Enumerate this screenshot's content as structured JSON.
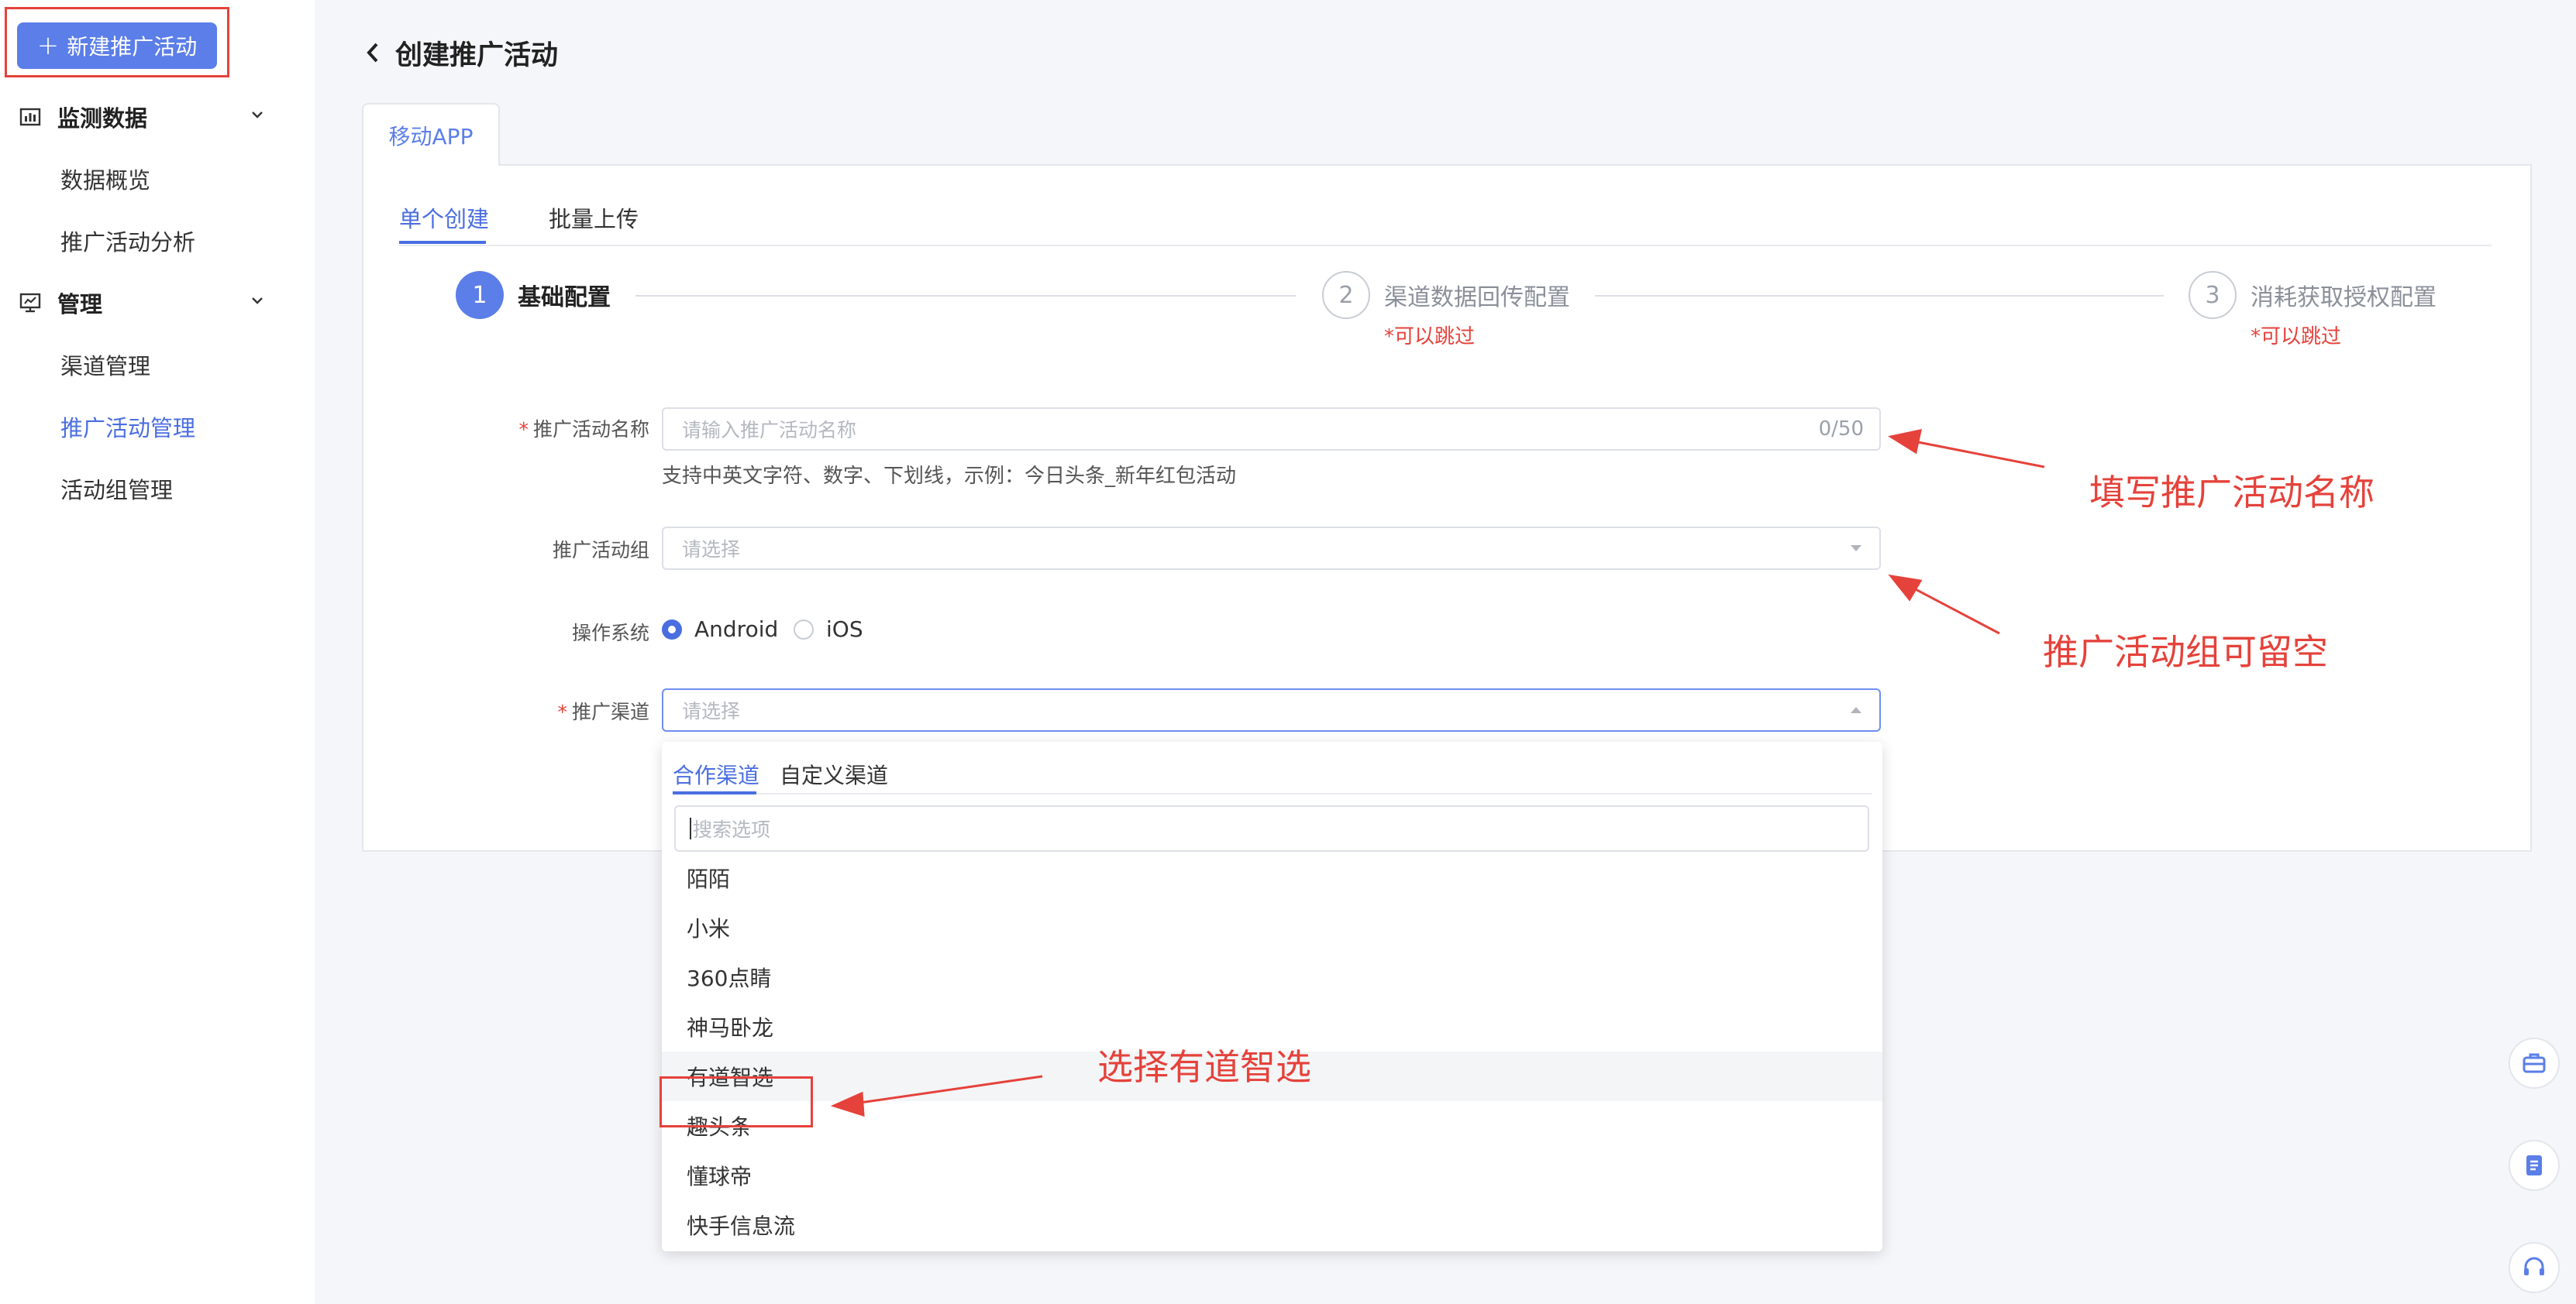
{
  "sidebar": {
    "new_button": {
      "label": "新建推广活动"
    },
    "groups": [
      {
        "label": "监测数据",
        "items": [
          "数据概览",
          "推广活动分析"
        ]
      },
      {
        "label": "管理",
        "items": [
          "渠道管理",
          "推广活动管理",
          "活动组管理"
        ]
      }
    ],
    "active_item": "推广活动管理"
  },
  "header": {
    "title": "创建推广活动"
  },
  "app_tab": {
    "label": "移动APP"
  },
  "subtabs": [
    "单个创建",
    "批量上传"
  ],
  "steps": [
    {
      "num": "1",
      "label": "基础配置",
      "note": ""
    },
    {
      "num": "2",
      "label": "渠道数据回传配置",
      "note": "*可以跳过"
    },
    {
      "num": "3",
      "label": "消耗获取授权配置",
      "note": "*可以跳过"
    }
  ],
  "form": {
    "name_label": "推广活动名称",
    "name_placeholder": "请输入推广活动名称",
    "name_count": "0/50",
    "name_hint": "支持中英文字符、数字、下划线，示例：今日头条_新年红包活动",
    "group_label": "推广活动组",
    "group_placeholder": "请选择",
    "os_label": "操作系统",
    "os_options": [
      "Android",
      "iOS"
    ],
    "os_selected": "Android",
    "channel_label": "推广渠道",
    "channel_placeholder": "请选择"
  },
  "dropdown": {
    "tabs": [
      "合作渠道",
      "自定义渠道"
    ],
    "search_placeholder": "搜索选项",
    "items": [
      "陌陌",
      "小米",
      "360点睛",
      "神马卧龙",
      "有道智选",
      "趣头条",
      "懂球帝",
      "快手信息流"
    ],
    "highlighted": "有道智选"
  },
  "annotations": {
    "name": "填写推广活动名称",
    "group": "推广活动组可留空",
    "choose": "选择有道智选"
  },
  "colors": {
    "primary": "#5b7ee8",
    "annotation": "#e5423b"
  }
}
